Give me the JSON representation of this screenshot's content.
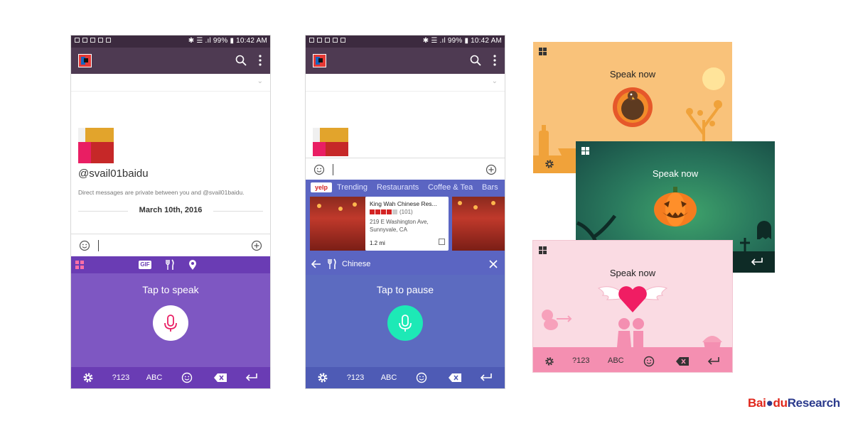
{
  "status": {
    "battery": "99%",
    "time": "10:42 AM"
  },
  "phone1": {
    "username": "@svail01baidu",
    "dm_note": "Direct messages are private between you and @svail01baidu.",
    "date": "March 10th, 2016",
    "keyboard_top": {
      "gif": "GIF"
    },
    "prompt": "Tap to speak",
    "bottom": {
      "num": "?123",
      "abc": "ABC"
    }
  },
  "phone2": {
    "yelp": {
      "logo": "yelp",
      "tabs": [
        "Trending",
        "Restaurants",
        "Coffee & Tea",
        "Bars"
      ]
    },
    "card": {
      "name": "King Wah Chinese Res...",
      "reviews": "(101)",
      "addr1": "219 E Washington Ave,",
      "addr2": "Sunnyvale, CA",
      "distance": "1.2 mi",
      "rating": 4.5
    },
    "category": "Chinese",
    "prompt": "Tap to pause",
    "bottom": {
      "num": "?123",
      "abc": "ABC"
    }
  },
  "themes": [
    {
      "name": "thanksgiving",
      "speak": "Speak now",
      "bg": "#f9c27a"
    },
    {
      "name": "halloween",
      "speak": "Speak now",
      "bg": "#2a7a5e"
    },
    {
      "name": "valentine",
      "speak": "Speak now",
      "bg": "#fadbe3",
      "bottom": {
        "num": "?123",
        "abc": "ABC"
      }
    }
  ],
  "brand": {
    "part1": "Bai",
    "part2": "du",
    "part3": "Research"
  },
  "colors": {
    "purple": "#7e57c2",
    "indigo": "#5c6bc0",
    "mic_pink": "#e91e63",
    "mic_teal": "#1de9b6"
  }
}
